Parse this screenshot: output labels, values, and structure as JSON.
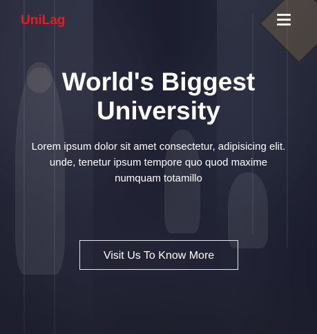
{
  "header": {
    "logo": "UniLag",
    "menu_icon": "hamburger-menu-icon"
  },
  "hero": {
    "title": "World's Biggest University",
    "description_line_1": "Lorem ipsum dolor sit amet consectetur, adipisicing elit.",
    "description_line_2": "unde, tenetur ipsum tempore quo quod maxime numquam totamillo",
    "cta_label": "Visit Us To Know More"
  },
  "colors": {
    "brand": "#e41c24",
    "text": "#ffffff",
    "overlay": "#1c1d2c"
  }
}
